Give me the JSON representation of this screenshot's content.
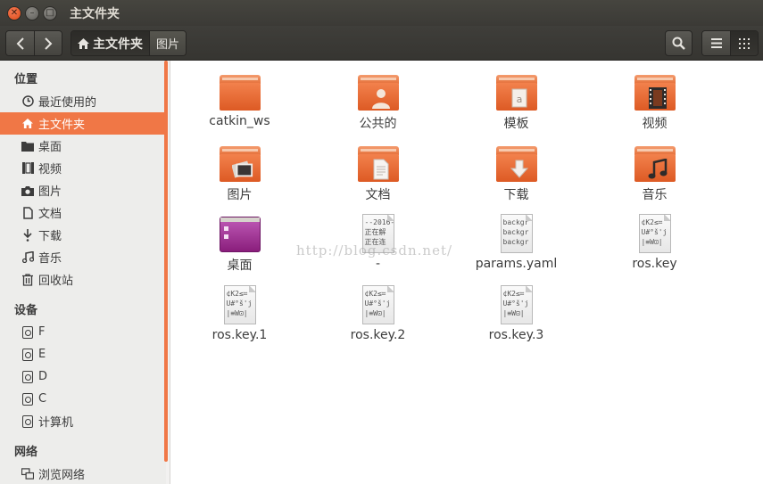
{
  "window": {
    "title": "主文件夹"
  },
  "toolbar": {
    "back_icon": "chevron-left",
    "forward_icon": "chevron-right",
    "breadcrumbs": [
      {
        "label": "主文件夹",
        "icon": "home-icon"
      },
      {
        "label": "图片"
      }
    ]
  },
  "sidebar": {
    "sections": [
      {
        "title": "位置",
        "items": [
          {
            "label": "最近使用的",
            "icon": "clock-icon"
          },
          {
            "label": "主文件夹",
            "icon": "home-icon",
            "selected": true
          },
          {
            "label": "桌面",
            "icon": "desktop-folder-icon"
          },
          {
            "label": "视频",
            "icon": "film-icon"
          },
          {
            "label": "图片",
            "icon": "camera-icon"
          },
          {
            "label": "文档",
            "icon": "document-icon"
          },
          {
            "label": "下载",
            "icon": "download-icon"
          },
          {
            "label": "音乐",
            "icon": "music-icon"
          },
          {
            "label": "回收站",
            "icon": "trash-icon"
          }
        ]
      },
      {
        "title": "设备",
        "items": [
          {
            "label": "F",
            "icon": "drive-icon"
          },
          {
            "label": "E",
            "icon": "drive-icon"
          },
          {
            "label": "D",
            "icon": "drive-icon"
          },
          {
            "label": "C",
            "icon": "drive-icon"
          },
          {
            "label": "计算机",
            "icon": "computer-icon"
          }
        ]
      },
      {
        "title": "网络",
        "items": [
          {
            "label": "浏览网络",
            "icon": "network-icon"
          }
        ]
      }
    ]
  },
  "files": [
    {
      "name": "catkin_ws",
      "type": "folder",
      "emblem": ""
    },
    {
      "name": "公共的",
      "type": "folder",
      "emblem": "person"
    },
    {
      "name": "模板",
      "type": "folder",
      "emblem": "template"
    },
    {
      "name": "视频",
      "type": "folder",
      "emblem": "film"
    },
    {
      "name": "图片",
      "type": "folder",
      "emblem": "picture"
    },
    {
      "name": "文档",
      "type": "folder",
      "emblem": "document"
    },
    {
      "name": "下载",
      "type": "folder",
      "emblem": "download"
    },
    {
      "name": "音乐",
      "type": "folder",
      "emblem": "music"
    },
    {
      "name": "桌面",
      "type": "desktop"
    },
    {
      "name": "-",
      "type": "text",
      "preview": [
        "--2016-",
        "正在解",
        "正在连"
      ]
    },
    {
      "name": "params.yaml",
      "type": "text",
      "preview": [
        "backgr",
        "backgr",
        "backgr"
      ]
    },
    {
      "name": "ros.key",
      "type": "text",
      "preview": [
        "¢K2≤⌗",
        "U#°š'j",
        "|≡W⊡|"
      ]
    },
    {
      "name": "ros.key.1",
      "type": "text",
      "preview": [
        "¢K2≤⌗",
        "U#°š'j",
        "|≡W⊡|"
      ]
    },
    {
      "name": "ros.key.2",
      "type": "text",
      "preview": [
        "¢K2≤⌗",
        "U#°š'j",
        "|≡W⊡|"
      ]
    },
    {
      "name": "ros.key.3",
      "type": "text",
      "preview": [
        "¢K2≤⌗",
        "U#°š'j",
        "|≡W⊡|"
      ]
    }
  ],
  "watermark": "http://blog.csdn.net/",
  "colors": {
    "accent": "#f07746",
    "titlebar": "#3c3b37",
    "folder": "#e8703a"
  }
}
